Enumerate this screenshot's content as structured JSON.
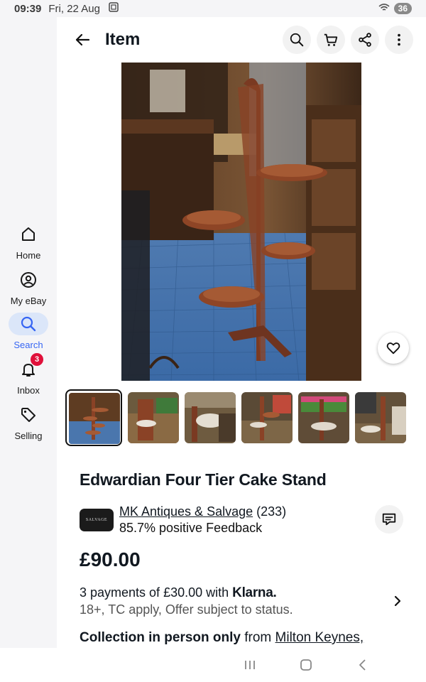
{
  "status_bar": {
    "time": "09:39",
    "date": "Fri, 22 Aug",
    "battery": "36"
  },
  "rail": {
    "items": [
      {
        "label": "Home",
        "icon": "home-icon"
      },
      {
        "label": "My eBay",
        "icon": "account-icon"
      },
      {
        "label": "Search",
        "icon": "search-icon",
        "active": true
      },
      {
        "label": "Inbox",
        "icon": "bell-icon",
        "badge": "3"
      },
      {
        "label": "Selling",
        "icon": "tag-icon"
      }
    ]
  },
  "header": {
    "title": "Item",
    "actions": [
      "search-icon",
      "cart-icon",
      "share-icon",
      "more-icon"
    ]
  },
  "listing": {
    "title": "Edwardian Four Tier Cake Stand",
    "thumbnail_count": 6,
    "selected_thumbnail": 1,
    "seller": {
      "logo_text": "SALVAGE",
      "name": "MK Antiques & Salvage",
      "rating_count": "(233)",
      "feedback": "85.7% positive Feedback"
    },
    "price": "£90.00",
    "klarna": {
      "prefix": "3 payments of £30.00 with",
      "brand": "Klarna.",
      "terms": "18+, TC apply, Offer subject to status."
    },
    "collection": {
      "bold": "Collection in person only",
      "from": "from",
      "location": "Milton Keynes,"
    }
  },
  "colors": {
    "accent": "#3665f3",
    "badge": "#e0103a",
    "rail_bg": "#f5f5f7"
  }
}
